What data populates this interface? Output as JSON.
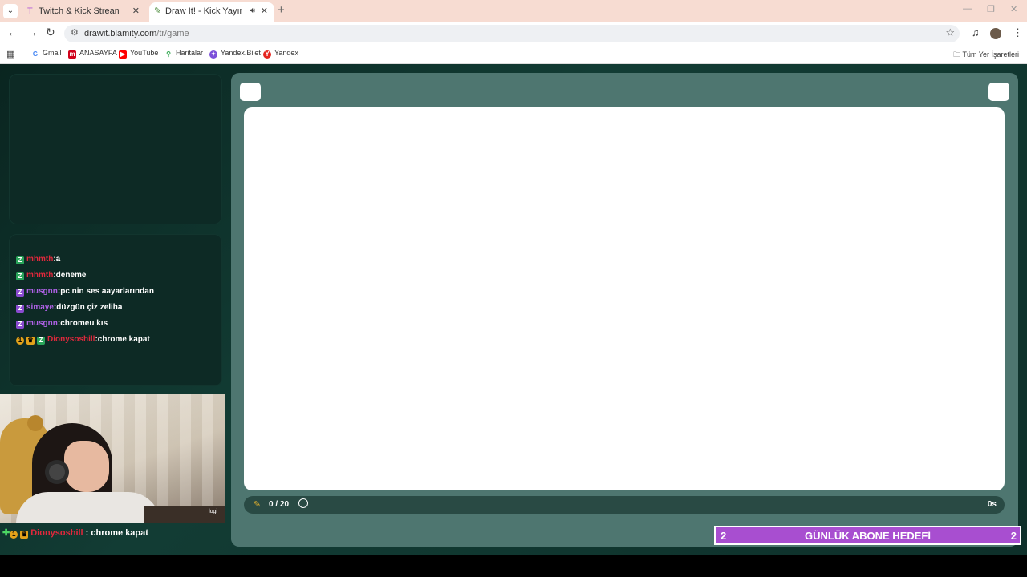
{
  "browser": {
    "tabs": [
      {
        "title": "Twitch & Kick Stream Games",
        "active": false,
        "icon": "twitch-kick-icon"
      },
      {
        "title": "Draw It! - Kick Yayınları İçin",
        "active": true,
        "icon": "drawit-icon"
      }
    ],
    "url_domain": "drawit.blamity.com",
    "url_path": "/tr/game",
    "bookmarks": [
      {
        "label": "Gmail",
        "icon": "google-icon",
        "color": "#ffffff"
      },
      {
        "label": "ANASAYFA",
        "icon": "m-icon",
        "color": "#d0021b"
      },
      {
        "label": "YouTube",
        "icon": "youtube-icon",
        "color": "#ff0000"
      },
      {
        "label": "Haritalar",
        "icon": "maps-icon",
        "color": "#34a853"
      },
      {
        "label": "Yandex.Bilet",
        "icon": "yandex-bilet-icon",
        "color": "#7b4fd9"
      },
      {
        "label": "Yandex",
        "icon": "yandex-icon",
        "color": "#e52620"
      }
    ],
    "all_bookmarks_label": "Tüm Yer İşaretleri"
  },
  "chat": {
    "messages": [
      {
        "badges": [
          "z-green"
        ],
        "user": "mhmth",
        "user_color": "#e0283c",
        "text": ":a"
      },
      {
        "badges": [
          "z-green"
        ],
        "user": "mhmth",
        "user_color": "#e0283c",
        "text": ":deneme"
      },
      {
        "badges": [
          "z-purple"
        ],
        "user": "musgnn",
        "user_color": "#b062e8",
        "text": ":pc nin ses aayarlarından"
      },
      {
        "badges": [
          "z-purple"
        ],
        "user": "simaye",
        "user_color": "#b062e8",
        "text": ":düzgün çiz zeliha"
      },
      {
        "badges": [
          "z-purple"
        ],
        "user": "musgnn",
        "user_color": "#b062e8",
        "text": ":chromeu kıs"
      },
      {
        "badges": [
          "gold",
          "crown",
          "z-green"
        ],
        "user": "Dionysoshill",
        "user_color": "#e0283c",
        "text": ":chrome kapat"
      }
    ]
  },
  "webcam": {
    "label": "logi"
  },
  "alert": {
    "user": "Dionysoshill",
    "text": " : chrome kapat"
  },
  "game": {
    "progress": "0 / 20",
    "time": "0s"
  },
  "goal": {
    "left": "2",
    "title": "GÜNLÜK ABONE HEDEFİ",
    "right": "2",
    "color": "#a84ed0"
  }
}
